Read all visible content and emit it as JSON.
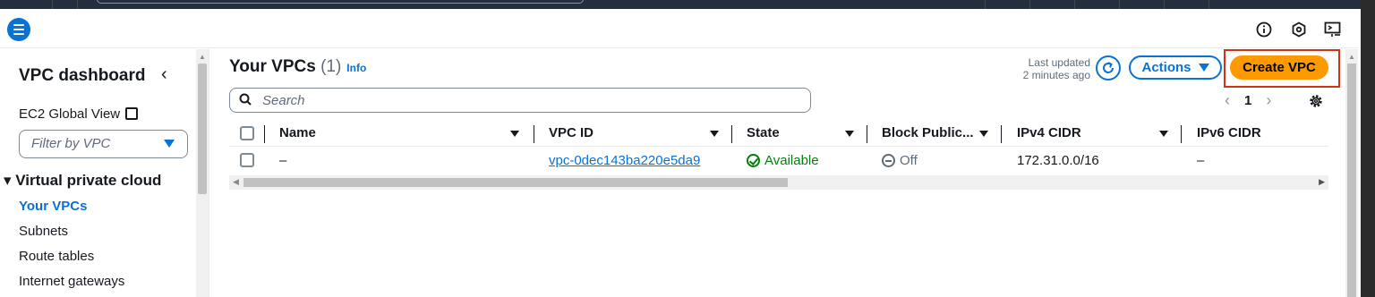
{
  "sidebar": {
    "title": "VPC dashboard",
    "ec2_global_view": "EC2 Global View",
    "filter_placeholder": "Filter by VPC",
    "section": "Virtual private cloud",
    "items": [
      {
        "label": "Your VPCs",
        "active": true
      },
      {
        "label": "Subnets",
        "active": false
      },
      {
        "label": "Route tables",
        "active": false
      },
      {
        "label": "Internet gateways",
        "active": false
      }
    ]
  },
  "main": {
    "title": "Your VPCs",
    "count": "(1)",
    "info": "Info",
    "last_updated_line1": "Last updated",
    "last_updated_line2": "2 minutes ago",
    "actions_label": "Actions",
    "create_label": "Create VPC",
    "search_placeholder": "Search",
    "page_number": "1"
  },
  "table": {
    "columns": [
      "Name",
      "VPC ID",
      "State",
      "Block Public...",
      "IPv4 CIDR",
      "IPv6 CIDR"
    ],
    "rows": [
      {
        "name": "–",
        "vpc_id": "vpc-0dec143ba220e5da9",
        "state": "Available",
        "block_public": "Off",
        "ipv4": "172.31.0.0/16",
        "ipv6": "–"
      }
    ]
  },
  "icons": {
    "menu": "hamburger-menu-icon",
    "info": "info-circle-icon",
    "notifications": "hexagon-icon",
    "cloudshell": "cloudshell-icon"
  },
  "colors": {
    "accent": "#0972d3",
    "primary_button": "#ff9900",
    "highlight_frame": "#d13212",
    "success": "#037f0c"
  }
}
